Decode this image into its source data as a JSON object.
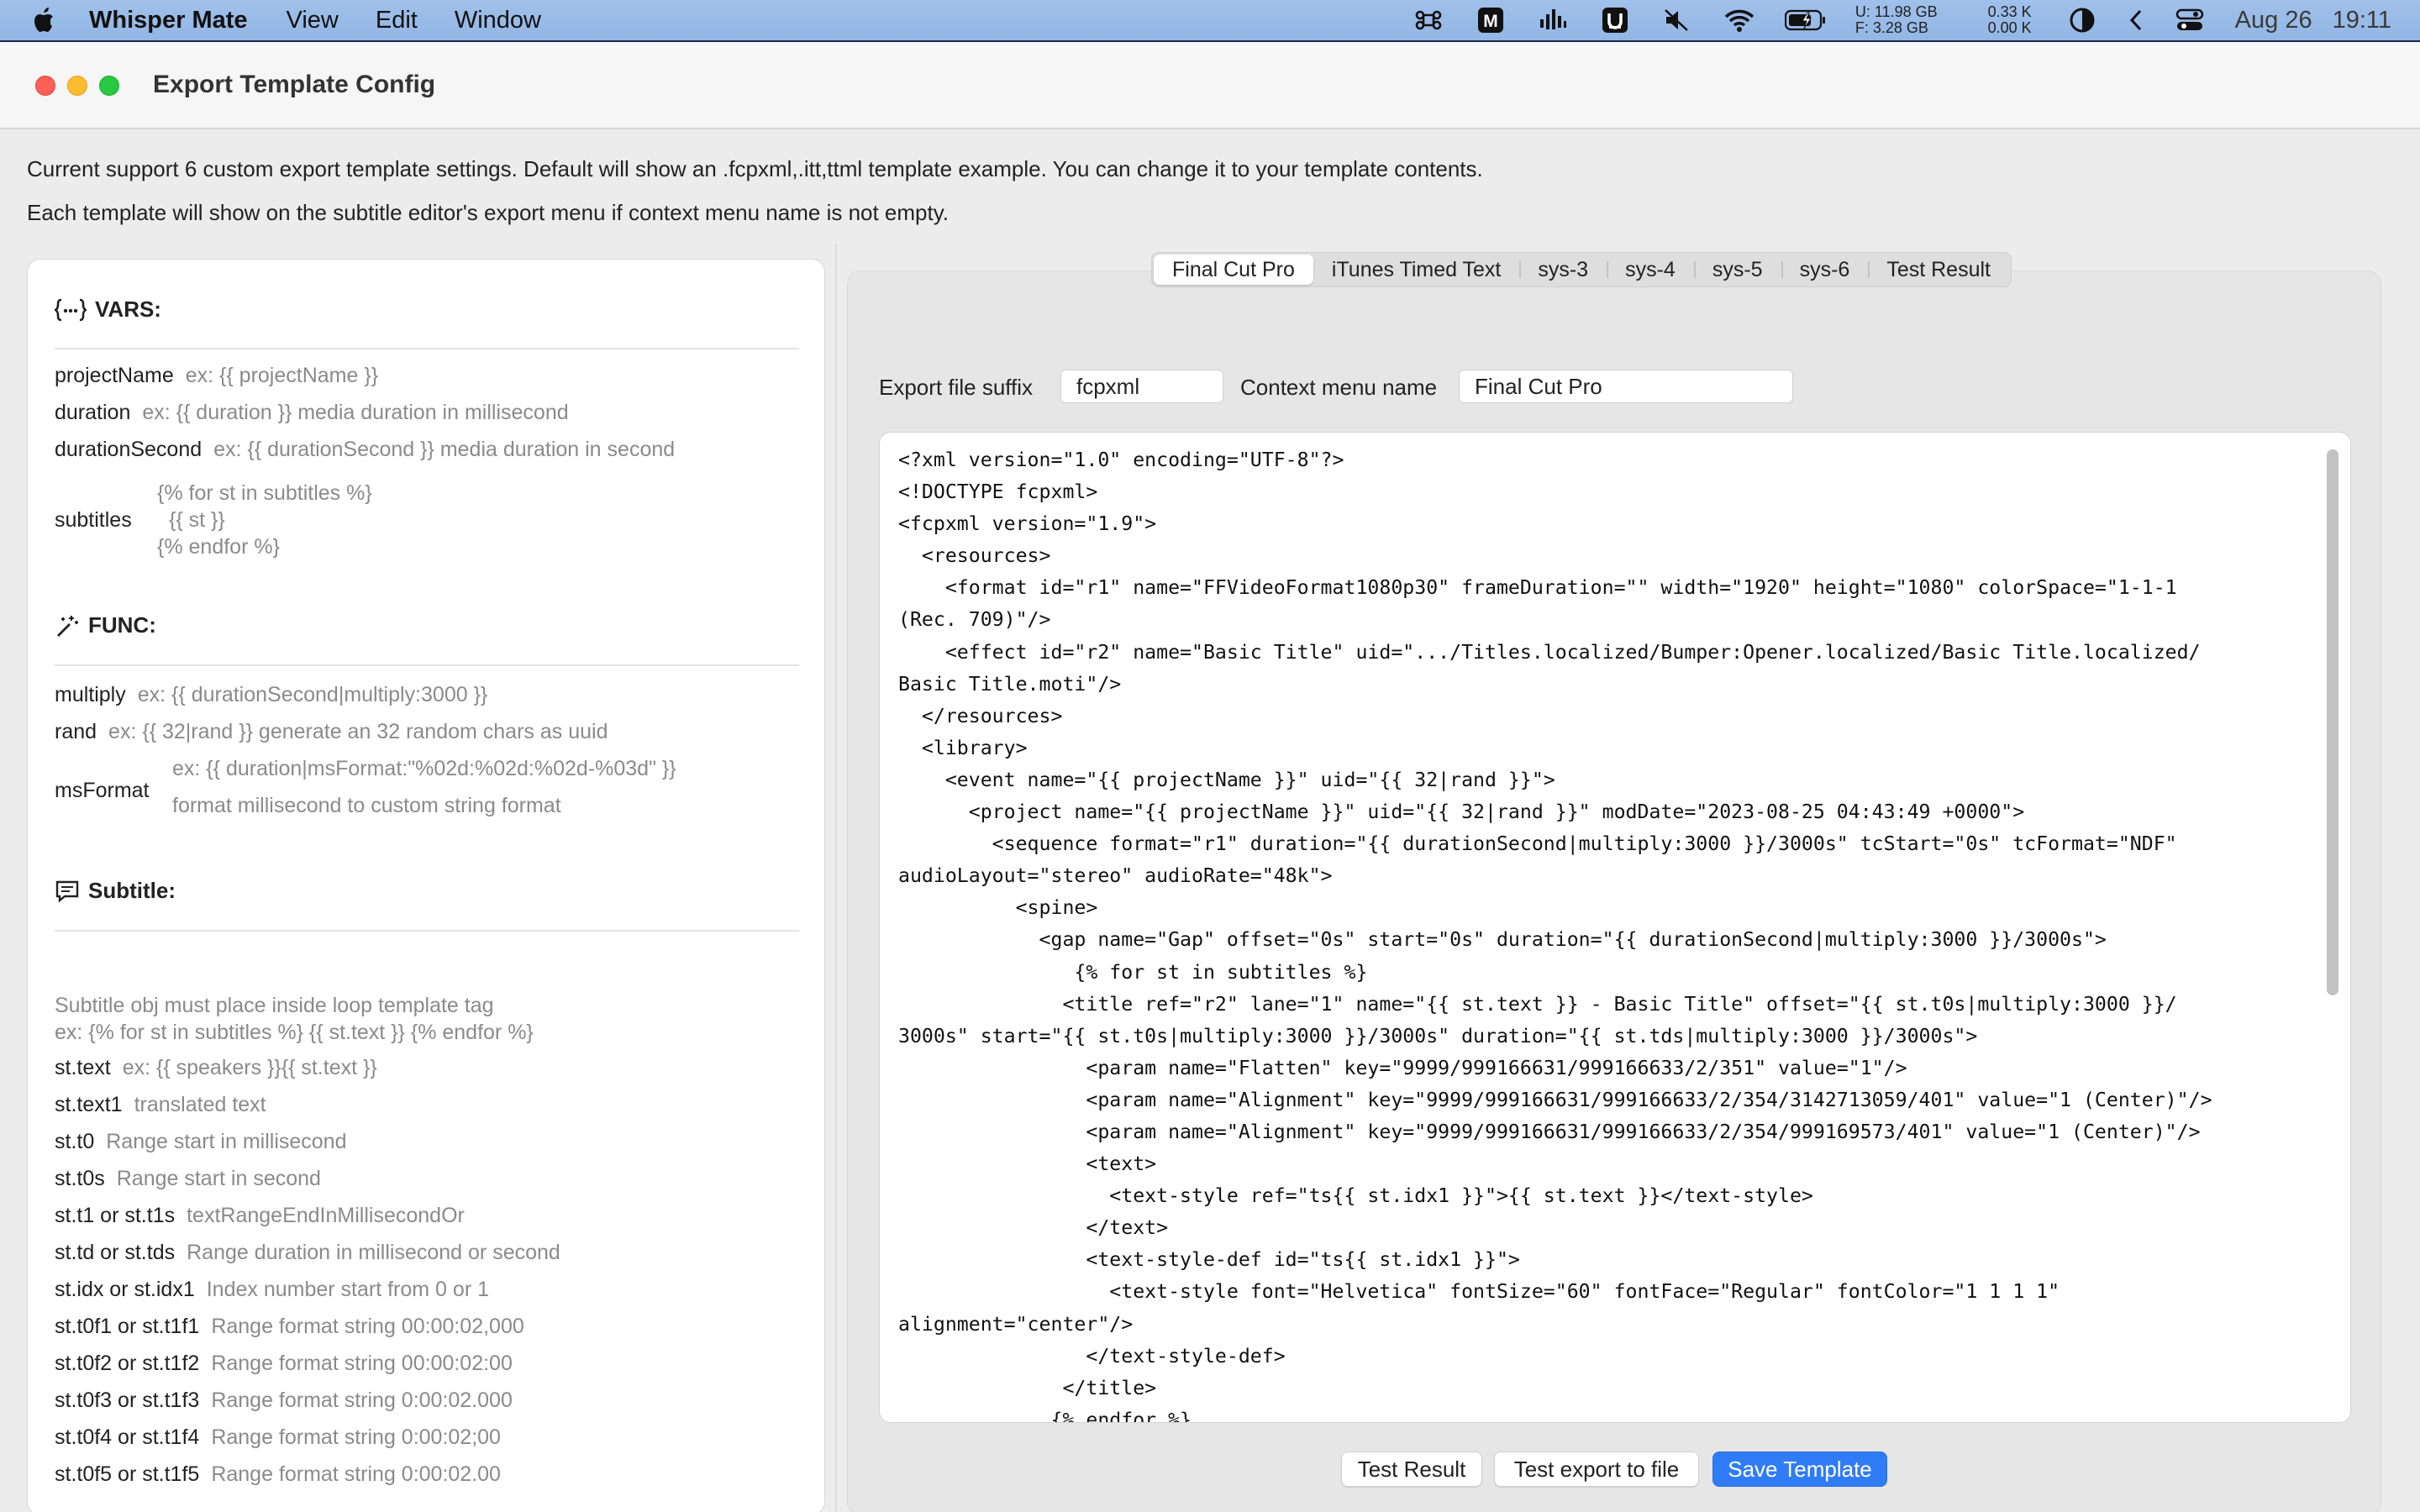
{
  "menubar": {
    "app_name": "Whisper Mate",
    "menus": [
      "View",
      "Edit",
      "Window"
    ],
    "stats": {
      "u": "U:  11.98 GB",
      "f": "F:   3.28 GB",
      "up": "0.33 K",
      "down": "0.00 K"
    },
    "date": "Aug 26",
    "time": "19:11",
    "icons": [
      "command-icon",
      "m-icon",
      "audio-icon",
      "calendar-icon",
      "mute-icon",
      "wifi-icon",
      "battery-icon",
      "moon-icon",
      "chevron-left-icon",
      "control-center-icon"
    ]
  },
  "window": {
    "title": "Export Template Config",
    "desc1": "Current support 6 custom export template settings. Default will show an .fcpxml,.itt,ttml template example. You can change it to your template contents.",
    "desc2": "Each template will show on the subtitle editor's export menu if context menu name is not empty."
  },
  "left": {
    "vars_title": "VARS:",
    "vars": [
      {
        "name": "projectName",
        "desc": "ex: {{ projectName }}"
      },
      {
        "name": "duration",
        "desc": "ex: {{ duration }} media duration in millisecond"
      },
      {
        "name": "durationSecond",
        "desc": "ex: {{ durationSecond }} media duration in second"
      }
    ],
    "subtitles_var": {
      "name": "subtitles",
      "l1": "{% for st in subtitles %}",
      "l2": "{{ st }}",
      "l3": "{% endfor %}"
    },
    "func_title": "FUNC:",
    "funcs": [
      {
        "name": "multiply",
        "desc": "ex: {{ durationSecond|multiply:3000 }}"
      },
      {
        "name": "rand",
        "desc": "ex: {{ 32|rand }} generate an 32 random chars as uuid"
      }
    ],
    "msformat": {
      "name": "msFormat",
      "l1": "ex: {{ duration|msFormat:\"%02d:%02d:%02d-%03d\" }}",
      "l2": "format millisecond to custom string format"
    },
    "subtitle_title": "Subtitle:",
    "subtitle_note1": "Subtitle obj must place inside loop template tag",
    "subtitle_note2": "ex: {% for st in subtitles %} {{ st.text }} {% endfor %}",
    "subtitle_props": [
      {
        "name": "st.text",
        "desc": "ex: {{ speakers }}{{ st.text }}"
      },
      {
        "name": "st.text1",
        "desc": "translated text"
      },
      {
        "name": "st.t0",
        "desc": "Range start in millisecond"
      },
      {
        "name": "st.t0s",
        "desc": "Range start in second"
      },
      {
        "name": "st.t1 or st.t1s",
        "desc": "textRangeEndInMillisecondOr"
      },
      {
        "name": "st.td or st.tds",
        "desc": "Range duration in millisecond or second"
      },
      {
        "name": "st.idx or st.idx1",
        "desc": "Index number start from 0 or 1"
      },
      {
        "name": "st.t0f1 or st.t1f1",
        "desc": "Range format string 00:00:02,000"
      },
      {
        "name": "st.t0f2 or st.t1f2",
        "desc": "Range format string 00:00:02:00"
      },
      {
        "name": "st.t0f3 or st.t1f3",
        "desc": "Range format string 0:00:02.000"
      },
      {
        "name": "st.t0f4 or st.t1f4",
        "desc": "Range format string 0:00:02;00"
      },
      {
        "name": "st.t0f5 or st.t1f5",
        "desc": "Range format string 0:00:02.00"
      }
    ]
  },
  "tabs": [
    "Final Cut Pro",
    "iTunes Timed Text",
    "sys-3",
    "sys-4",
    "sys-5",
    "sys-6",
    "Test Result"
  ],
  "form": {
    "suffix_label": "Export file suffix",
    "suffix_value": "fcpxml",
    "menu_label": "Context menu name",
    "menu_value": "Final Cut Pro"
  },
  "code_lines": [
    "<?xml version=\"1.0\" encoding=\"UTF-8\"?>",
    "<!DOCTYPE fcpxml>",
    "<fcpxml version=\"1.9\">",
    "  <resources>",
    "    <format id=\"r1\" name=\"FFVideoFormat1080p30\" frameDuration=\"\" width=\"1920\" height=\"1080\" colorSpace=\"1-1-1",
    "(Rec. 709)\"/>",
    "    <effect id=\"r2\" name=\"Basic Title\" uid=\".../Titles.localized/Bumper:Opener.localized/Basic Title.localized/",
    "Basic Title.moti\"/>",
    "  </resources>",
    "  <library>",
    "    <event name=\"{{ projectName }}\" uid=\"{{ 32|rand }}\">",
    "      <project name=\"{{ projectName }}\" uid=\"{{ 32|rand }}\" modDate=\"2023-08-25 04:43:49 +0000\">",
    "        <sequence format=\"r1\" duration=\"{{ durationSecond|multiply:3000 }}/3000s\" tcStart=\"0s\" tcFormat=\"NDF\"",
    "audioLayout=\"stereo\" audioRate=\"48k\">",
    "          <spine>",
    "            <gap name=\"Gap\" offset=\"0s\" start=\"0s\" duration=\"{{ durationSecond|multiply:3000 }}/3000s\">",
    "               {% for st in subtitles %}",
    "              <title ref=\"r2\" lane=\"1\" name=\"{{ st.text }} - Basic Title\" offset=\"{{ st.t0s|multiply:3000 }}/",
    "3000s\" start=\"{{ st.t0s|multiply:3000 }}/3000s\" duration=\"{{ st.tds|multiply:3000 }}/3000s\">",
    "                <param name=\"Flatten\" key=\"9999/999166631/999166633/2/351\" value=\"1\"/>",
    "                <param name=\"Alignment\" key=\"9999/999166631/999166633/2/354/3142713059/401\" value=\"1 (Center)\"/>",
    "                <param name=\"Alignment\" key=\"9999/999166631/999166633/2/354/999169573/401\" value=\"1 (Center)\"/>",
    "                <text>",
    "                  <text-style ref=\"ts{{ st.idx1 }}\">{{ st.text }}</text-style>",
    "                </text>",
    "                <text-style-def id=\"ts{{ st.idx1 }}\">",
    "                  <text-style font=\"Helvetica\" fontSize=\"60\" fontFace=\"Regular\" fontColor=\"1 1 1 1\"",
    "alignment=\"center\"/>",
    "                </text-style-def>",
    "              </title>",
    "             {% endfor %}"
  ],
  "buttons": {
    "test_result": "Test Result",
    "test_export": "Test export to file",
    "save": "Save Template"
  },
  "colors": {
    "accent": "#2f7cf6",
    "close": "#fe5f57",
    "minimize": "#febc2e",
    "maximize": "#28c840"
  }
}
